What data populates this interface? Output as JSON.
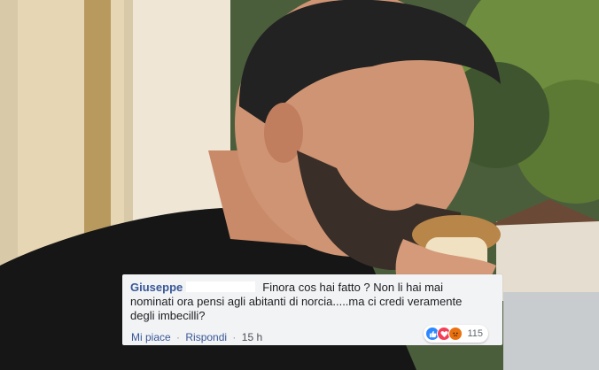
{
  "comment": {
    "author": "Giuseppe",
    "text": "Finora cos hai fatto ? Non li hai mai nominati ora pensi agli abitanti di norcia.....ma ci credi veramente degli imbecilli?",
    "actions": {
      "like_label": "Mi piace",
      "reply_label": "Rispondi",
      "separator": "·",
      "timestamp": "15 h"
    },
    "reactions": {
      "icons": [
        "like-icon",
        "love-icon",
        "angry-icon"
      ],
      "count": "115"
    }
  },
  "colors": {
    "author": "#385898",
    "card_background": "#f2f3f5",
    "like": "#2d88ff",
    "love": "#f33e58",
    "angry": "#e9710f"
  }
}
